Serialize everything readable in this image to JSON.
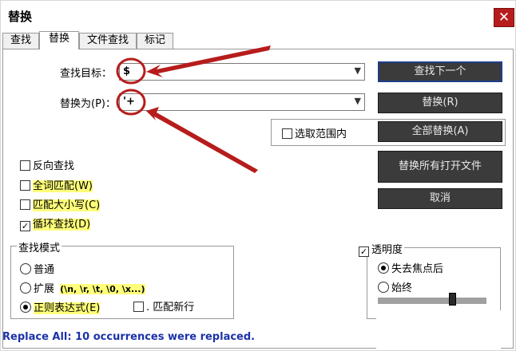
{
  "window": {
    "title": "替换",
    "close_label": "✕"
  },
  "tabs": [
    {
      "label": "查找"
    },
    {
      "label": "替换"
    },
    {
      "label": "文件查找"
    },
    {
      "label": "标记"
    }
  ],
  "find": {
    "label": "查找目标：",
    "value": "$"
  },
  "replace": {
    "label": "替换为(P)：",
    "value": "'+"
  },
  "buttons": {
    "find_next": "查找下一个",
    "replace": "替换(R)",
    "replace_all": "全部替换(A)",
    "replace_all_open": "替换所有打开文件",
    "cancel": "取消"
  },
  "in_selection": {
    "label": "选取范围内",
    "checked": false
  },
  "options": [
    {
      "label": "反向查找",
      "checked": false
    },
    {
      "label": "全词匹配(W)",
      "checked": false
    },
    {
      "label": "匹配大小写(C)",
      "checked": false
    },
    {
      "label": "循环查找(D)",
      "checked": true
    }
  ],
  "search_mode": {
    "title": "查找模式",
    "normal": "普通",
    "extended": "扩展",
    "extended_hint": "(\\n, \\r, \\t, \\0, \\x...)",
    "regex": "正则表达式(E)",
    "match_newline": ". 匹配新行",
    "selected": "regex"
  },
  "transparency": {
    "title": "透明度",
    "checked": true,
    "lose_focus": "失去焦点后",
    "always": "始终",
    "selected": "lose_focus",
    "level": 0.7
  },
  "status": {
    "text": "Replace All: 10 occurrences were replaced."
  },
  "colors": {
    "annotation": "#b71c1c",
    "status_text": "#1c32a8",
    "button_bg": "#3b3b3b"
  }
}
